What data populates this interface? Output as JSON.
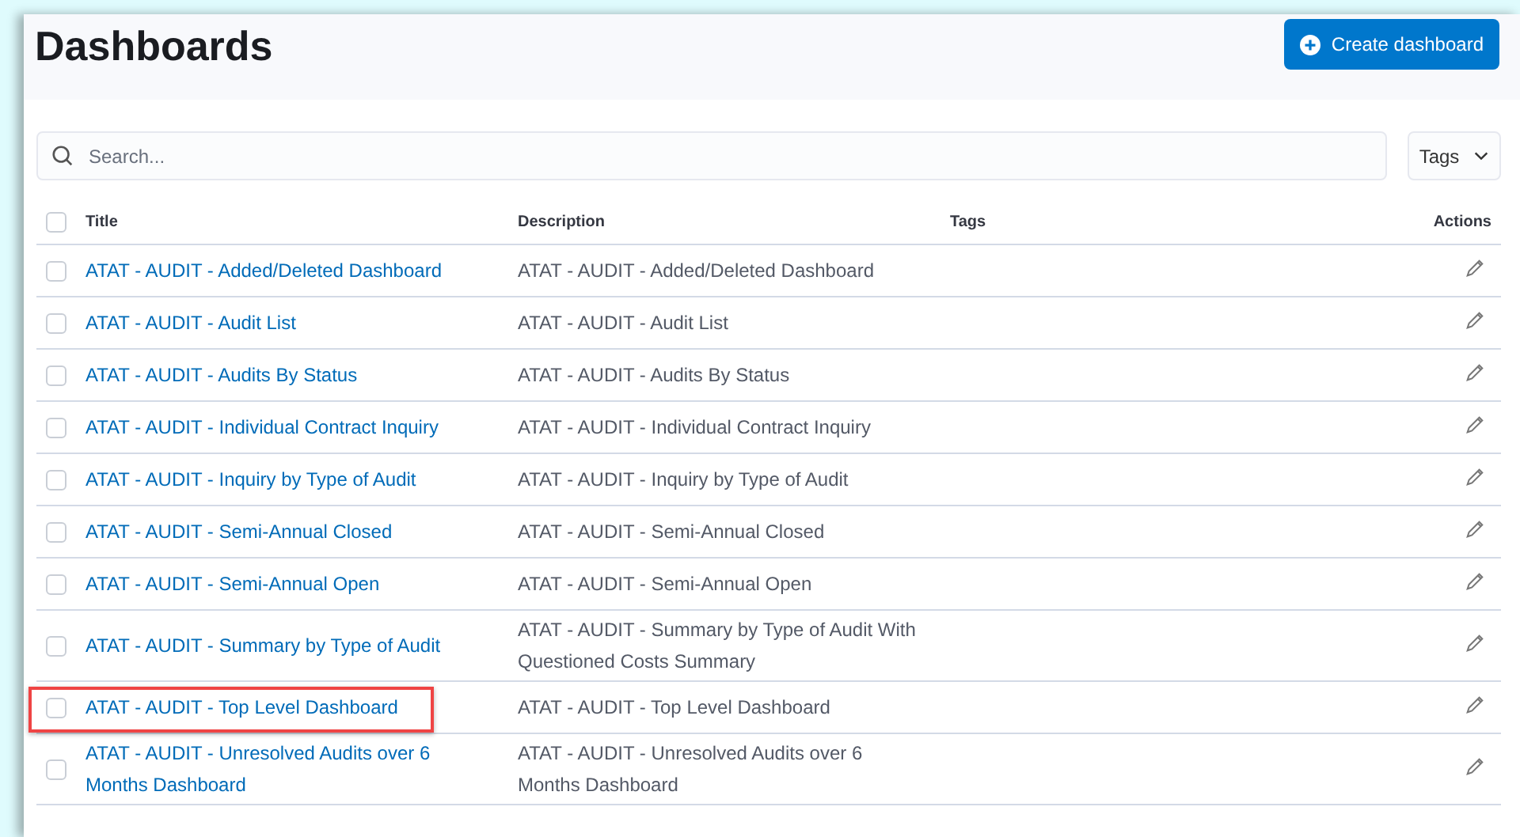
{
  "page": {
    "title": "Dashboards",
    "create_button": "Create dashboard"
  },
  "search": {
    "placeholder": "Search..."
  },
  "tags_filter": {
    "label": "Tags"
  },
  "table": {
    "columns": [
      "Title",
      "Description",
      "Tags",
      "Actions"
    ],
    "all_checked": false,
    "rows": [
      {
        "title": "ATAT - AUDIT - Added/Deleted Dashboard",
        "description": "ATAT - AUDIT - Added/Deleted Dashboard",
        "checked": false,
        "highlighted": false
      },
      {
        "title": "ATAT - AUDIT - Audit List",
        "description": "ATAT - AUDIT - Audit List",
        "checked": false,
        "highlighted": false
      },
      {
        "title": "ATAT - AUDIT - Audits By Status",
        "description": "ATAT - AUDIT - Audits By Status",
        "checked": false,
        "highlighted": false
      },
      {
        "title": "ATAT - AUDIT - Individual Contract Inquiry",
        "description": "ATAT - AUDIT - Individual Contract Inquiry",
        "checked": false,
        "highlighted": false
      },
      {
        "title": "ATAT - AUDIT - Inquiry by Type of Audit",
        "description": "ATAT - AUDIT - Inquiry by Type of Audit",
        "checked": false,
        "highlighted": false
      },
      {
        "title": "ATAT - AUDIT - Semi-Annual Closed",
        "description": "ATAT - AUDIT - Semi-Annual Closed",
        "checked": false,
        "highlighted": false
      },
      {
        "title": "ATAT - AUDIT - Semi-Annual Open",
        "description": "ATAT - AUDIT - Semi-Annual Open",
        "checked": false,
        "highlighted": false
      },
      {
        "title": "ATAT - AUDIT - Summary by Type of Audit",
        "description": "ATAT - AUDIT - Summary by Type of Audit With Questioned Costs Summary",
        "checked": false,
        "highlighted": false
      },
      {
        "title": "ATAT - AUDIT - Top Level Dashboard",
        "description": "ATAT - AUDIT - Top Level Dashboard",
        "checked": false,
        "highlighted": true
      },
      {
        "title": "ATAT - AUDIT - Unresolved Audits over 6 Months Dashboard",
        "description": "ATAT - AUDIT - Unresolved Audits over 6 Months Dashboard",
        "checked": false,
        "highlighted": false
      }
    ]
  }
}
